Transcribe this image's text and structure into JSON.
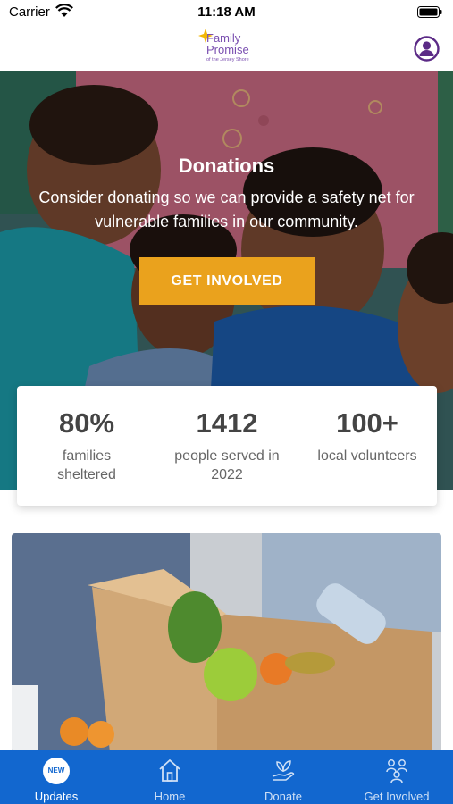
{
  "status_bar": {
    "carrier": "Carrier",
    "time": "11:18 AM"
  },
  "header": {
    "logo_line1": "Family",
    "logo_line2": "Promise",
    "logo_line3": "of the Jersey Shore"
  },
  "hero": {
    "title": "Donations",
    "text": "Consider donating so we can provide a safety net for vulnerable families in our community.",
    "button_label": "GET INVOLVED"
  },
  "stats": [
    {
      "value": "80%",
      "label": "families sheltered"
    },
    {
      "value": "1412",
      "label": "people served in 2022"
    },
    {
      "value": "100+",
      "label": "local volunteers"
    }
  ],
  "tabs": [
    {
      "label": "Updates",
      "icon": "new-badge-icon",
      "badge": "NEW",
      "active": true
    },
    {
      "label": "Home",
      "icon": "home-icon",
      "active": false
    },
    {
      "label": "Donate",
      "icon": "donate-icon",
      "active": false
    },
    {
      "label": "Get Involved",
      "icon": "people-icon",
      "active": false
    }
  ],
  "colors": {
    "accent": "#eaa21d",
    "tab_bar": "#1267cf",
    "brand": "#7a4fb0"
  }
}
